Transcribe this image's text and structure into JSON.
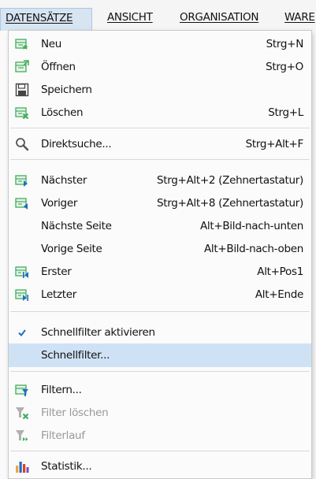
{
  "menubar": {
    "items": [
      {
        "label": "DATENSÄTZE"
      },
      {
        "label": "ANSICHT"
      },
      {
        "label": "ORGANISATION"
      },
      {
        "label": "WARE"
      }
    ]
  },
  "menu": {
    "items": [
      {
        "label": "Neu",
        "shortcut": "Strg+N",
        "icon": "new-record-icon"
      },
      {
        "label": "Öffnen",
        "shortcut": "Strg+O",
        "icon": "open-record-icon"
      },
      {
        "label": "Speichern",
        "shortcut": "",
        "icon": "save-icon"
      },
      {
        "label": "Löschen",
        "shortcut": "Strg+L",
        "icon": "delete-record-icon"
      },
      {
        "label": "Direktsuche...",
        "shortcut": "Strg+Alt+F",
        "icon": "search-icon"
      },
      {
        "label": "Nächster",
        "shortcut": "Strg+Alt+2 (Zehnertastatur)",
        "icon": "next-record-icon"
      },
      {
        "label": "Voriger",
        "shortcut": "Strg+Alt+8 (Zehnertastatur)",
        "icon": "previous-record-icon"
      },
      {
        "label": "Nächste Seite",
        "shortcut": "Alt+Bild-nach-unten",
        "icon": ""
      },
      {
        "label": "Vorige Seite",
        "shortcut": "Alt+Bild-nach-oben",
        "icon": ""
      },
      {
        "label": "Erster",
        "shortcut": "Alt+Pos1",
        "icon": "first-record-icon"
      },
      {
        "label": "Letzter",
        "shortcut": "Alt+Ende",
        "icon": "last-record-icon"
      },
      {
        "label": "Schnellfilter aktivieren",
        "shortcut": "",
        "icon": "checkmark-icon",
        "checked": true
      },
      {
        "label": "Schnellfilter...",
        "shortcut": "",
        "icon": "",
        "highlighted": true
      },
      {
        "label": "Filtern...",
        "shortcut": "",
        "icon": "filter-icon"
      },
      {
        "label": "Filter löschen",
        "shortcut": "",
        "icon": "filter-clear-icon",
        "disabled": true
      },
      {
        "label": "Filterlauf",
        "shortcut": "",
        "icon": "filter-run-icon",
        "disabled": true
      },
      {
        "label": "Statistik...",
        "shortcut": "",
        "icon": "statistics-icon"
      }
    ]
  },
  "colors": {
    "highlight": "#cfe2f5",
    "active_menubar": "#d7e4f2",
    "icon_green": "#3fae5a",
    "icon_blue": "#1d6fc4"
  }
}
